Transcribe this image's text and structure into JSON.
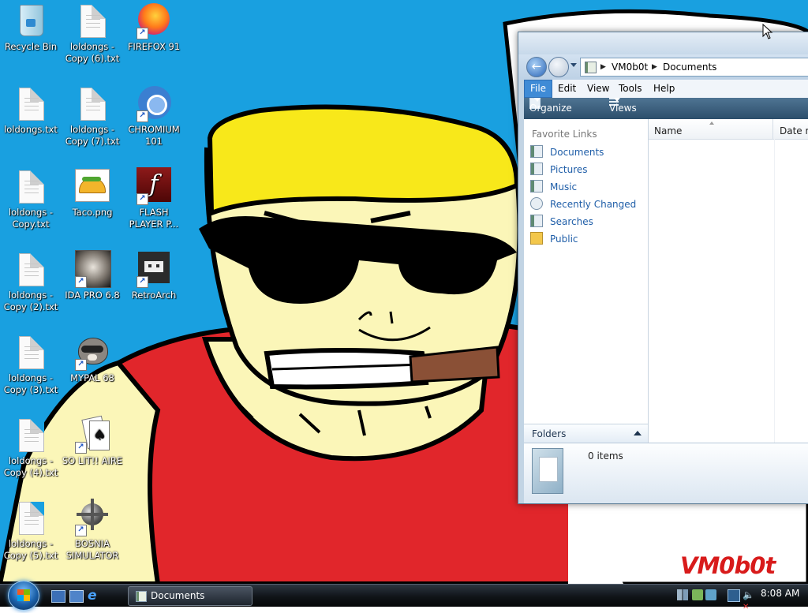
{
  "desktop": {
    "icons": [
      {
        "label": "Recycle Bin"
      },
      {
        "label": "loldongs - Copy (6).txt"
      },
      {
        "label": "FIREFOX 91"
      },
      {
        "label": "loldongs.txt"
      },
      {
        "label": "loldongs - Copy (7).txt"
      },
      {
        "label": "CHROMIUM 101"
      },
      {
        "label": "loldongs - Copy.txt"
      },
      {
        "label": "Taco.png"
      },
      {
        "label": "FLASH PLAYER P..."
      },
      {
        "label": "loldongs - Copy (2).txt"
      },
      {
        "label": "IDA PRO 6.8"
      },
      {
        "label": "RetroArch"
      },
      {
        "label": "loldongs - Copy (3).txt"
      },
      {
        "label": "MYPAL 68"
      },
      {
        "label": "loldongs - Copy (4).txt"
      },
      {
        "label": "SO LIT!! AIRE"
      },
      {
        "label": "loldongs - Copy (5).txt"
      },
      {
        "label": "BOSNIA SIMULATOR"
      }
    ],
    "watermark": "VM0b0t",
    "colors": {
      "background": "#19a0e0",
      "hat": "#f8e81a",
      "skin": "#fbf6b8",
      "shirt": "#e1262b",
      "cigar": "#8a5036"
    }
  },
  "explorer": {
    "address": {
      "root": "VM0b0t",
      "folder": "Documents"
    },
    "menu": {
      "file": "File",
      "edit": "Edit",
      "view": "View",
      "tools": "Tools",
      "help": "Help"
    },
    "toolbar": {
      "organize": "Organize",
      "views": "Views"
    },
    "nav": {
      "header": "Favorite Links",
      "links": [
        "Documents",
        "Pictures",
        "Music",
        "Recently Changed",
        "Searches",
        "Public"
      ],
      "folders_label": "Folders"
    },
    "columns": {
      "name": "Name",
      "date": "Date m"
    },
    "details": {
      "count": "0 items"
    }
  },
  "taskbar": {
    "task": "Documents",
    "clock": "8:08 AM"
  }
}
